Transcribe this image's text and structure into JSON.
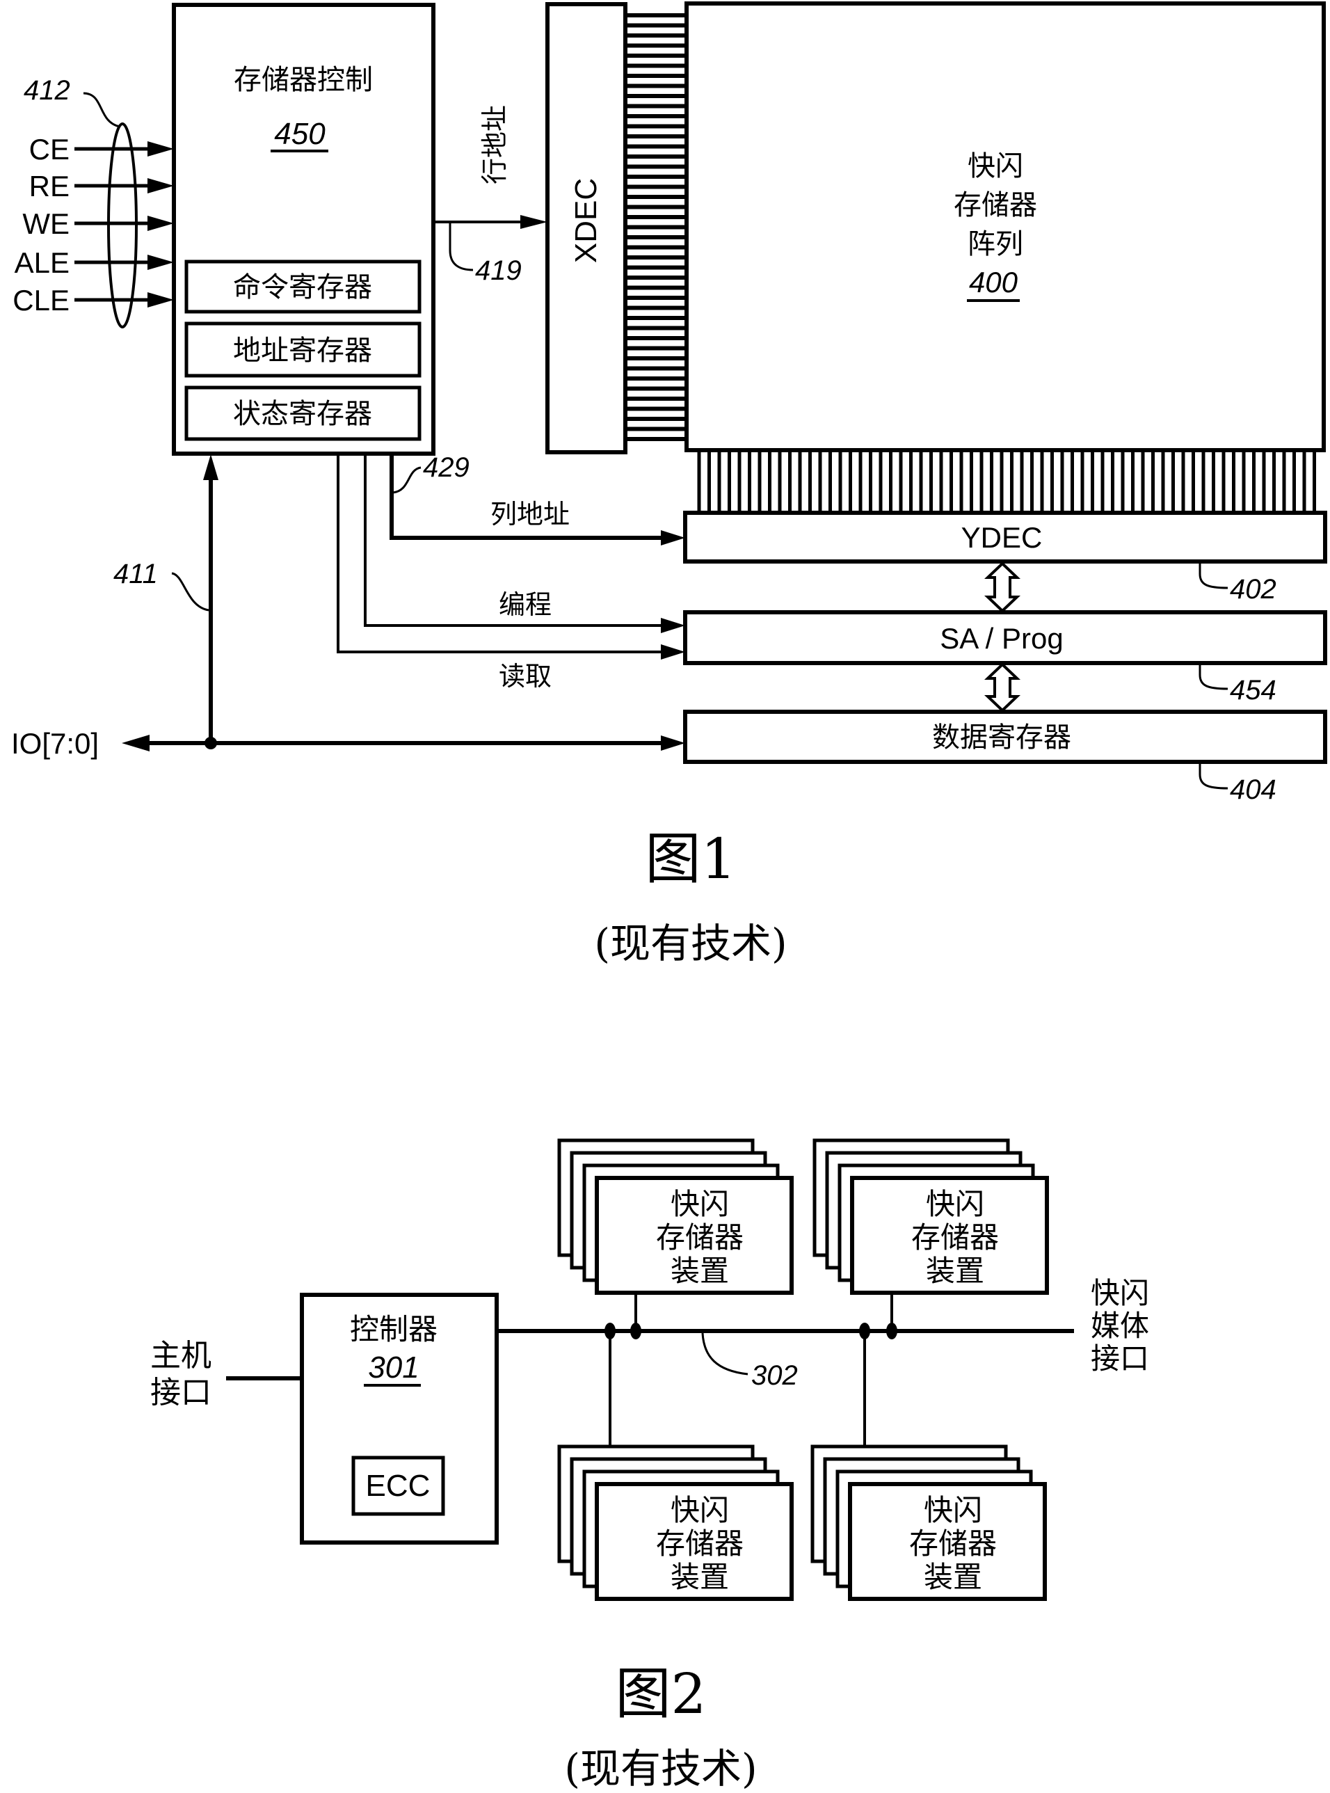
{
  "figure1": {
    "memory_control": {
      "label": "存储器控制",
      "ref": "450"
    },
    "registers": [
      {
        "label": "命令寄存器"
      },
      {
        "label": "地址寄存器"
      },
      {
        "label": "状态寄存器"
      }
    ],
    "control_signals": [
      "CE",
      "RE",
      "WE",
      "ALE",
      "CLE"
    ],
    "control_bus_ref": "412",
    "row_address": {
      "label": "行地址",
      "ref": "419"
    },
    "xdec": {
      "label": "XDEC"
    },
    "array": {
      "lines": [
        "快闪",
        "存储器",
        "阵列"
      ],
      "ref": "400"
    },
    "column_address": {
      "label": "列地址",
      "ref": "429"
    },
    "program": {
      "label": "编程"
    },
    "read": {
      "label": "读取"
    },
    "ydec": {
      "label": "YDEC",
      "ref": "402"
    },
    "sa_prog": {
      "label": "SA / Prog",
      "ref": "454"
    },
    "data_register": {
      "label": "数据寄存器",
      "ref": "404"
    },
    "io": {
      "label": "IO[7:0]",
      "ref": "411"
    },
    "caption": {
      "title": "图1",
      "subtitle": "(现有技术)"
    }
  },
  "figure2": {
    "host_interface": {
      "lines": [
        "主机",
        "接口"
      ]
    },
    "controller": {
      "label": "控制器",
      "ref": "301",
      "ecc": "ECC"
    },
    "bus_ref": "302",
    "flash_media_interface": {
      "lines": [
        "快闪",
        "媒体",
        "接口"
      ]
    },
    "devices": [
      {
        "lines": [
          "快闪",
          "存储器",
          "装置"
        ],
        "position": "top-left"
      },
      {
        "lines": [
          "快闪",
          "存储器",
          "装置"
        ],
        "position": "top-right"
      },
      {
        "lines": [
          "快闪",
          "存储器",
          "装置"
        ],
        "position": "bottom-left"
      },
      {
        "lines": [
          "快闪",
          "存储器",
          "装置"
        ],
        "position": "bottom-right"
      }
    ],
    "caption": {
      "title": "图2",
      "subtitle": "(现有技术)"
    }
  }
}
